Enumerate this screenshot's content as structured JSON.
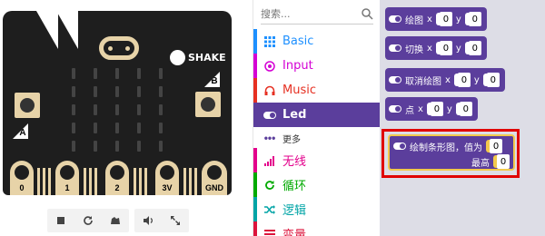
{
  "simulator": {
    "shake_label": "SHAKE",
    "button_a_label": "A",
    "button_b_label": "B",
    "pins": [
      "0",
      "1",
      "2",
      "3V",
      "GND"
    ],
    "controls": [
      "stop-icon",
      "restart-icon",
      "debug-icon",
      "mute-icon",
      "fullscreen-icon"
    ]
  },
  "toolbox": {
    "search_placeholder": "搜索...",
    "categories": [
      {
        "label": "Basic",
        "color": "#1e90ff",
        "icon": "grid-icon"
      },
      {
        "label": "Input",
        "color": "#d400d4",
        "icon": "target-icon"
      },
      {
        "label": "Music",
        "color": "#e63022",
        "icon": "headphones-icon"
      },
      {
        "label": "Led",
        "color": "#5b3e9c",
        "icon": "toggle-icon",
        "active": true
      },
      {
        "label": "更多",
        "color": "#5b3e9c",
        "icon": "dots-icon"
      },
      {
        "label": "无线",
        "color": "#e3008c",
        "icon": "signal-icon"
      },
      {
        "label": "循环",
        "color": "#00aa00",
        "icon": "loop-icon"
      },
      {
        "label": "逻辑",
        "color": "#00a4a6",
        "icon": "shuffle-icon"
      },
      {
        "label": "变量",
        "color": "#dc143c",
        "icon": "list-icon"
      }
    ]
  },
  "workspace": {
    "blocks": [
      {
        "label": "绘图",
        "x_label": "x",
        "x": "0",
        "y_label": "y",
        "y": "0"
      },
      {
        "label": "切换",
        "x_label": "x",
        "x": "0",
        "y_label": "y",
        "y": "0"
      },
      {
        "label": "取消绘图",
        "x_label": "x",
        "x": "0",
        "y_label": "y",
        "y": "0"
      },
      {
        "label": "点",
        "x_label": "x",
        "x": "0",
        "y_label": "y",
        "y": "0"
      }
    ],
    "bar_graph_block": {
      "label": "绘制条形图，值为",
      "value": "0",
      "max_label": "最高",
      "max_value": "0"
    }
  }
}
